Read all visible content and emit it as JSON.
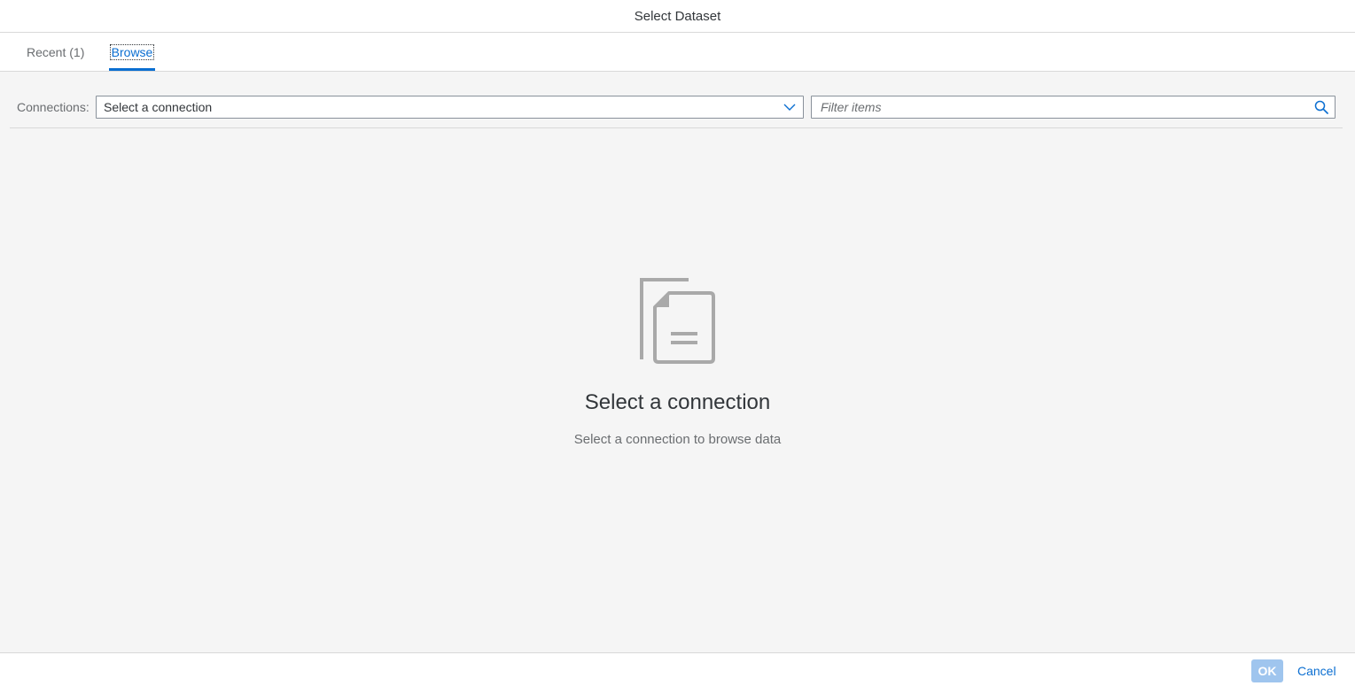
{
  "dialog": {
    "title": "Select Dataset"
  },
  "tabs": [
    {
      "label": "Recent (1)",
      "selected": false
    },
    {
      "label": "Browse",
      "selected": true
    }
  ],
  "toolbar": {
    "connections_label": "Connections:",
    "connection_select_value": "Select a connection",
    "filter_placeholder": "Filter items"
  },
  "empty_state": {
    "icon": "document-icon",
    "title": "Select a connection",
    "description": "Select a connection to browse data"
  },
  "footer": {
    "ok_label": "OK",
    "ok_enabled": false,
    "cancel_label": "Cancel"
  },
  "colors": {
    "accent": "#0a6ed1",
    "ok_disabled": "#9fc5ee",
    "background": "#f5f5f5",
    "icon_gray": "#a9a9a9"
  }
}
